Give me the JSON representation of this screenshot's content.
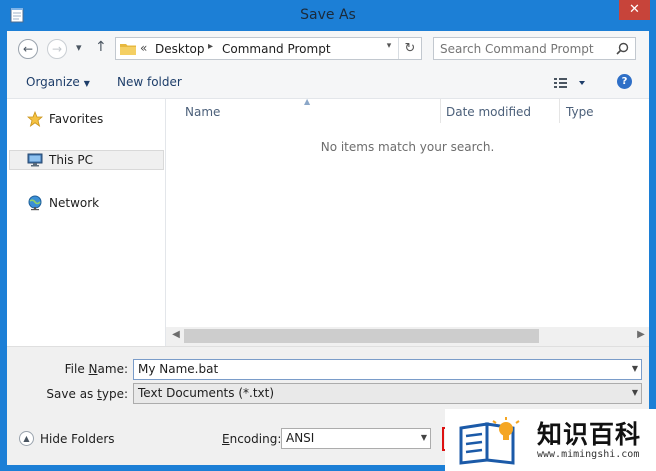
{
  "window": {
    "title": "Save As",
    "close_glyph": "✕",
    "accent_color": "#1c7fd6"
  },
  "addressbar": {
    "back_glyph": "←",
    "forward_glyph": "→",
    "recent_glyph": "▾",
    "up_glyph": "↑",
    "overflow": "«",
    "crumbs": [
      "Desktop",
      "Command Prompt"
    ],
    "separator_glyph": "▸",
    "dropdown_glyph": "▾",
    "refresh_glyph": "↻"
  },
  "search": {
    "placeholder": "Search Command Prompt"
  },
  "toolbar": {
    "organize_label": "Organize",
    "caret_glyph": "▼",
    "new_folder_label": "New folder",
    "help_glyph": "?"
  },
  "sidebar": {
    "items": [
      {
        "label": "Favorites",
        "icon": "star-icon"
      },
      {
        "label": "This PC",
        "icon": "computer-icon",
        "selected": true
      },
      {
        "label": "Network",
        "icon": "network-icon"
      }
    ]
  },
  "filelist": {
    "columns": [
      "Name",
      "Date modified",
      "Type"
    ],
    "sort_glyph": "▲",
    "empty_message": "No items match your search."
  },
  "scrollbar": {
    "left_glyph": "◀",
    "right_glyph": "▶"
  },
  "form": {
    "filename_label_u": "N",
    "filename_label_pre": "File ",
    "filename_label_post": "ame:",
    "filename_value": "My Name.bat",
    "savetype_label_pre": "Save as ",
    "savetype_label_u": "t",
    "savetype_label_post": "ype:",
    "savetype_value": "Text Documents (*.txt)",
    "encoding_label_u": "E",
    "encoding_label_post": "ncoding:",
    "encoding_value": "ANSI",
    "dropdown_glyph": "▼"
  },
  "footer": {
    "hide_folders_label": "Hide Folders",
    "hide_glyph": "▲"
  },
  "watermark": {
    "text": "知识百科",
    "url": "www.mimingshi.com"
  }
}
